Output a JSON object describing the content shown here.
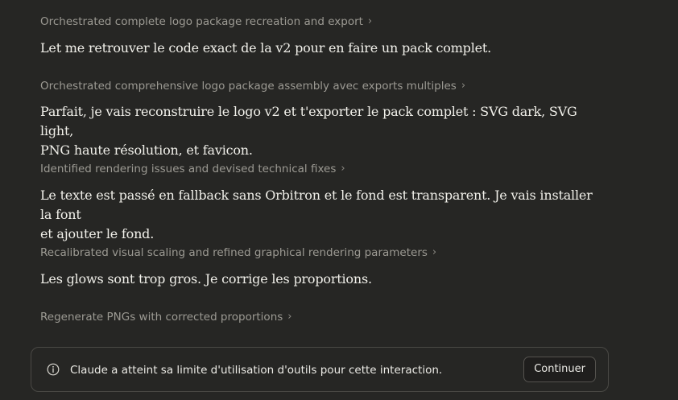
{
  "thread": {
    "items": [
      {
        "type": "step",
        "label": "Orchestrated complete logo package recreation and export",
        "chevron": "›"
      },
      {
        "type": "message",
        "text": "Let me retrouver le code exact de la v2 pour en faire un pack complet."
      },
      {
        "type": "step",
        "label": "Orchestrated comprehensive logo package assembly avec exports multiples",
        "chevron": "›"
      },
      {
        "type": "message",
        "lines": [
          "Parfait, je vais reconstruire le logo v2 et t'exporter le pack complet : SVG dark, SVG light,",
          "PNG haute résolution, et favicon."
        ]
      },
      {
        "type": "step",
        "label": "Identified rendering issues and devised technical fixes",
        "chevron": "›"
      },
      {
        "type": "message",
        "lines": [
          "Le texte est passé en fallback sans Orbitron et le fond est transparent. Je vais installer la font",
          "et ajouter le fond."
        ]
      },
      {
        "type": "step",
        "label": "Recalibrated visual scaling and refined graphical rendering parameters",
        "chevron": "›"
      },
      {
        "type": "message",
        "text": "Les glows sont trop gros. Je corrige les proportions."
      },
      {
        "type": "step",
        "label": "Regenerate PNGs with corrected proportions",
        "chevron": "›"
      }
    ]
  },
  "notice": {
    "icon": "info-icon",
    "text": "Claude a atteint sa limite d'utilisation d'outils pour cette interaction.",
    "button_label": "Continuer"
  },
  "colors": {
    "background": "#262624",
    "step_text": "#9c9a93",
    "message_text": "#f1f0ea",
    "notice_border": "#4a4945"
  }
}
